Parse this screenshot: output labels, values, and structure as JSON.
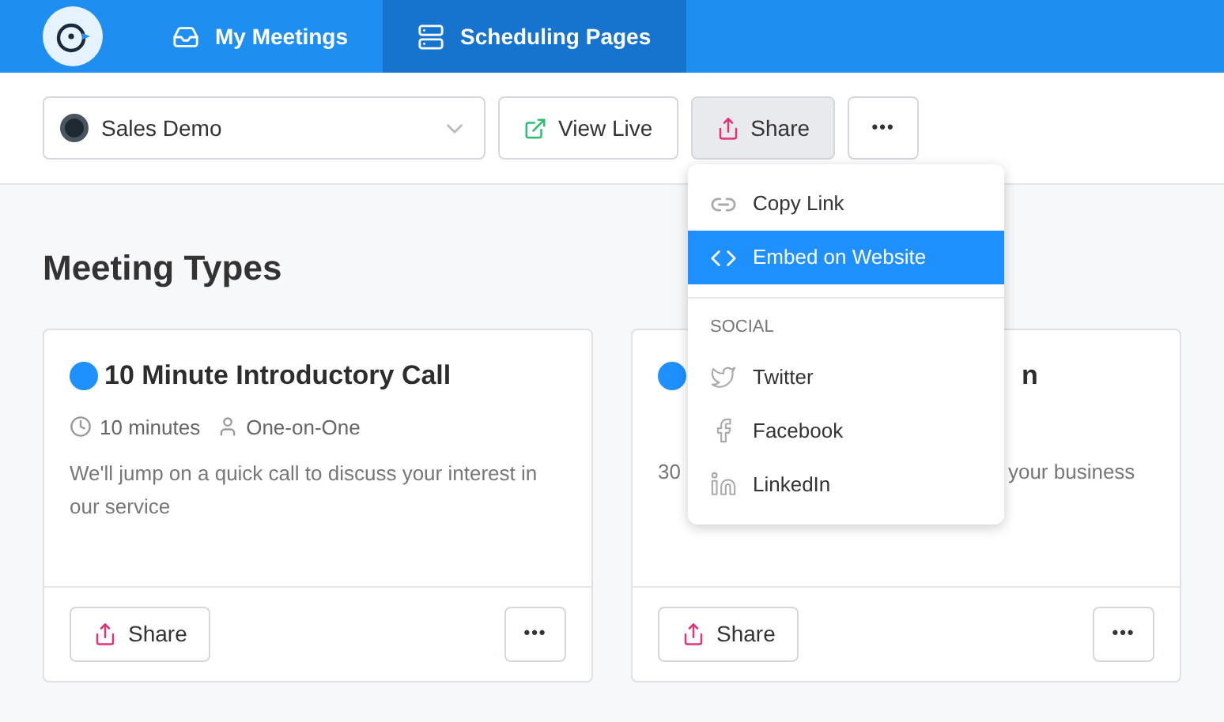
{
  "nav": {
    "tabs": [
      {
        "label": "My Meetings",
        "selected": false
      },
      {
        "label": "Scheduling Pages",
        "selected": true
      }
    ]
  },
  "toolbar": {
    "page_select": {
      "value": "Sales Demo"
    },
    "buttons": [
      {
        "label": "View Live",
        "kind": "view",
        "pressed": false
      },
      {
        "label": "Share",
        "kind": "share",
        "pressed": true
      },
      {
        "label": "•••",
        "kind": "more",
        "pressed": false
      }
    ]
  },
  "share_menu": {
    "items": [
      {
        "label": "Copy Link",
        "selected": false
      },
      {
        "label": "Embed on Website",
        "selected": true
      }
    ],
    "section": "SOCIAL",
    "social": [
      {
        "label": "Twitter"
      },
      {
        "label": "Facebook"
      },
      {
        "label": "LinkedIn"
      }
    ]
  },
  "heading": "Meeting Types",
  "cards": [
    {
      "kind": "full",
      "color": "#1e90ff",
      "title": "10 Minute Introductory Call",
      "duration": "10 minutes",
      "type": "One-on-One",
      "description": "We'll jump on a quick call to discuss your interest in our service",
      "share": "Share",
      "more": "•••"
    },
    {
      "kind": "covered",
      "color": "#1e90ff",
      "title": "n",
      "description_start": "30",
      "description_end": "your business",
      "share": "Share",
      "more": "•••"
    }
  ]
}
